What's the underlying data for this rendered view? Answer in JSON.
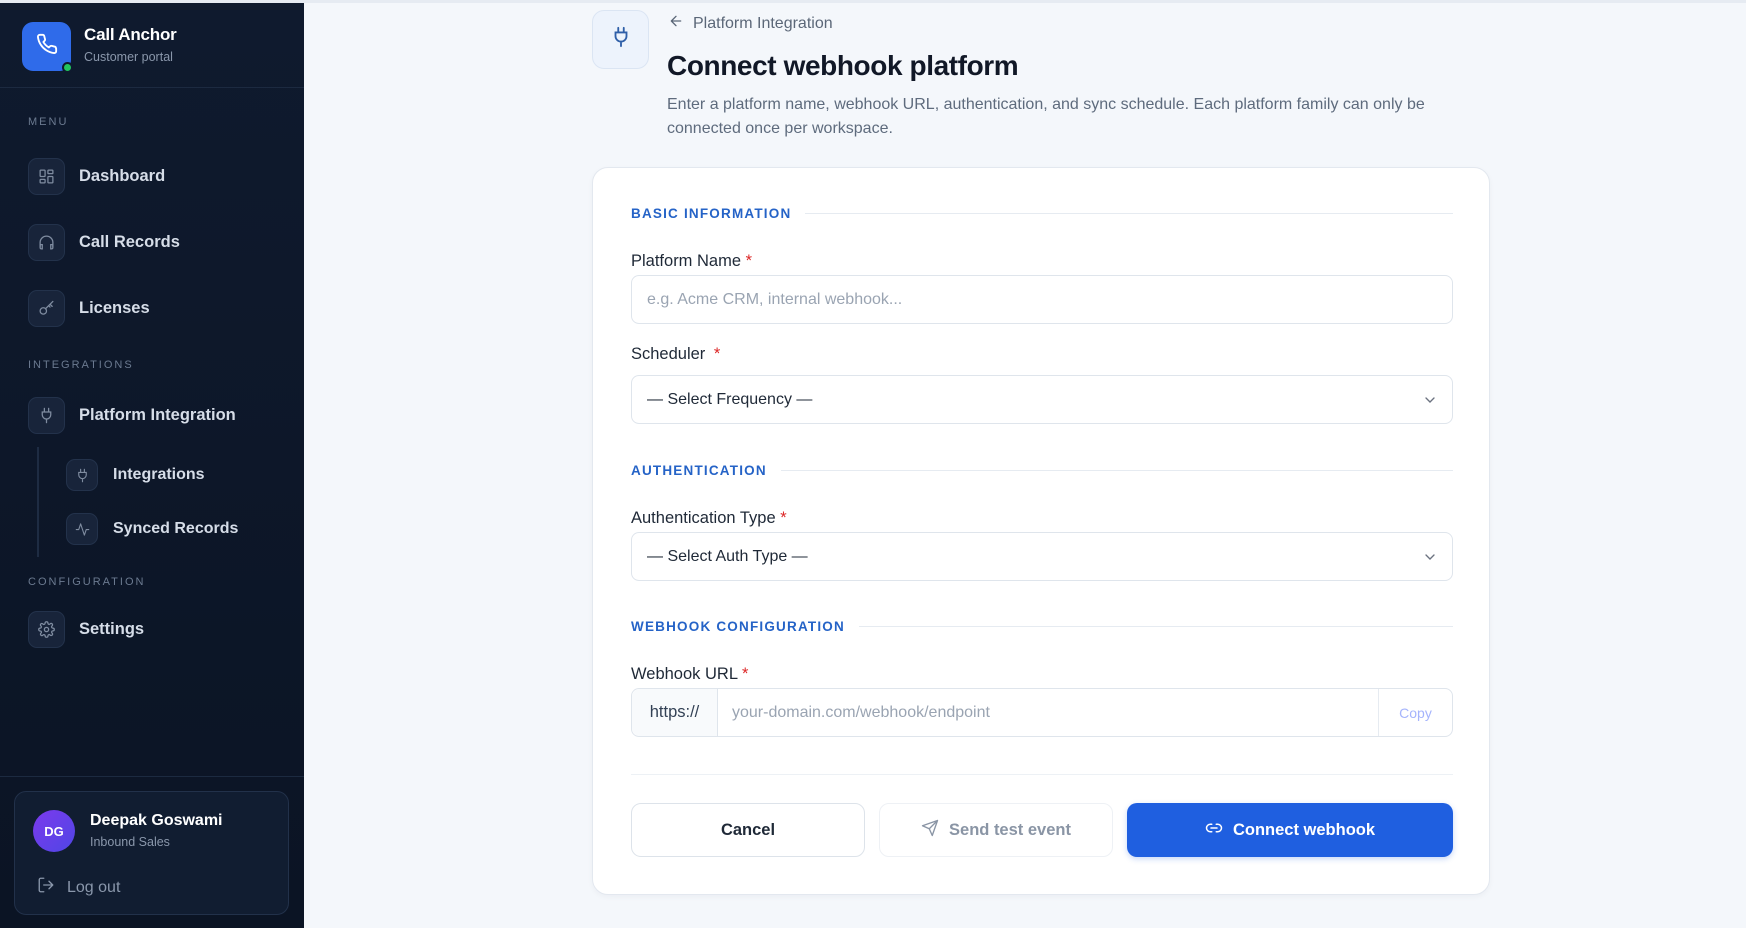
{
  "app": {
    "name": "Call Anchor",
    "subtitle": "Customer portal"
  },
  "sidebar": {
    "sections": {
      "menu": "MENU",
      "integrations": "INTEGRATIONS",
      "configuration": "CONFIGURATION"
    },
    "items": {
      "dashboard": "Dashboard",
      "call_records": "Call Records",
      "licenses": "Licenses",
      "platform_integration": "Platform Integration",
      "integrations": "Integrations",
      "synced_records": "Synced Records",
      "settings": "Settings"
    },
    "user": {
      "initials": "DG",
      "name": "Deepak Goswami",
      "role": "Inbound Sales",
      "logout": "Log out"
    }
  },
  "header": {
    "breadcrumb": "Platform Integration",
    "title": "Connect webhook platform",
    "description": "Enter a platform name, webhook URL, authentication, and sync schedule. Each platform family can only be connected once per workspace."
  },
  "form": {
    "sections": {
      "basic": "BASIC INFORMATION",
      "auth": "AUTHENTICATION",
      "webhook": "WEBHOOK CONFIGURATION"
    },
    "platform_name": {
      "label": "Platform Name",
      "required": "*",
      "placeholder": "e.g. Acme CRM, internal webhook..."
    },
    "scheduler": {
      "label": "Scheduler",
      "required": "*",
      "value": "— Select Frequency —"
    },
    "auth_type": {
      "label": "Authentication Type",
      "required": "*",
      "value": "— Select Auth Type —"
    },
    "webhook_url": {
      "label": "Webhook URL",
      "required": "*",
      "prefix": "https://",
      "placeholder": "your-domain.com/webhook/endpoint",
      "copy": "Copy"
    },
    "buttons": {
      "cancel": "Cancel",
      "test": "Send test event",
      "connect": "Connect webhook"
    }
  },
  "colors": {
    "accent": "#1f5fe0",
    "section_heading": "#2563c7",
    "sidebar_bg": "#0f1a2e",
    "required": "#dc2626",
    "online": "#22c55e"
  },
  "icons": [
    "phone-icon",
    "grid-icon",
    "headphones-icon",
    "key-icon",
    "plug-icon",
    "activity-icon",
    "gear-icon",
    "logout-icon",
    "arrow-left-icon",
    "chevron-down-icon",
    "send-icon",
    "link-icon"
  ]
}
